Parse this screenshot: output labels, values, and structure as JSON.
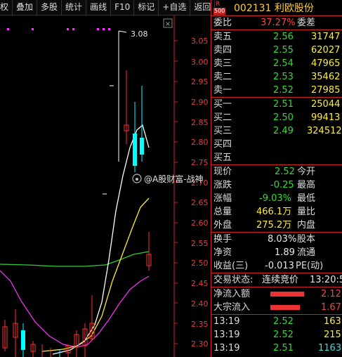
{
  "toolbar": {
    "items": [
      "权",
      "叠加",
      "多股",
      "统计",
      "画线",
      "F10",
      "标记",
      "+自选",
      "返回"
    ]
  },
  "chart": {
    "price_axis": [
      "3.05",
      "3.00",
      "2.95",
      "2.90",
      "2.85",
      "2.80",
      "2.75",
      "2.70",
      "2.65",
      "2.60",
      "2.55",
      "2.50",
      "2.45",
      "2.40",
      "2.35",
      "2.30"
    ],
    "high_label": "3.08",
    "watermark": "@A股财富-战神",
    "colors": {
      "up": "#ff3030",
      "down": "#00ffff",
      "ma_white": "#ffffff",
      "ma_yellow": "#ffff00",
      "ma_green": "#33cc33",
      "ma_magenta": "#ff33ff",
      "axis_text": "#e04040"
    }
  },
  "quote": {
    "badge_r": "R",
    "badge_num": "500",
    "code": "002131",
    "name": "利欧股份",
    "weibi_label": "委比",
    "weibi_value": "37.27%",
    "weicha_label": "委差",
    "asks": [
      {
        "label": "卖五",
        "price": "2.56",
        "vol": "31747"
      },
      {
        "label": "卖四",
        "price": "2.55",
        "vol": "62027"
      },
      {
        "label": "卖三",
        "price": "2.54",
        "vol": "47965"
      },
      {
        "label": "卖二",
        "price": "2.53",
        "vol": "35462"
      },
      {
        "label": "卖一",
        "price": "2.52",
        "vol": "27985"
      }
    ],
    "bids": [
      {
        "label": "买一",
        "price": "2.51",
        "vol": "25044"
      },
      {
        "label": "买二",
        "price": "2.50",
        "vol": "99413"
      },
      {
        "label": "买三",
        "price": "2.49",
        "vol": "324512"
      },
      {
        "label": "买四",
        "price": "",
        "vol": ""
      },
      {
        "label": "买五",
        "price": "",
        "vol": ""
      }
    ],
    "stats": [
      {
        "l1": "现价",
        "v1": "2.52",
        "l2": "今开",
        "color": "green"
      },
      {
        "l1": "涨跌",
        "v1": "-0.25",
        "l2": "最高",
        "color": "green"
      },
      {
        "l1": "涨幅",
        "v1": "-9.03%",
        "l2": "最低",
        "color": "green"
      },
      {
        "l1": "总量",
        "v1": "466.1万",
        "l2": "量比",
        "color": "yellow"
      },
      {
        "l1": "外盘",
        "v1": "275.2万",
        "l2": "内盘",
        "color": "yellow"
      }
    ],
    "stats2": [
      {
        "l1": "换手",
        "v1": "8.03%",
        "l2": "股本"
      },
      {
        "l1": "净资",
        "v1": "1.89",
        "l2": "流通"
      },
      {
        "l1": "收益(三)",
        "v1": "-0.013",
        "l2": "PE(动)"
      }
    ],
    "trade_status_label": "交易状态:",
    "trade_status_value": "连续竞价",
    "trade_time": "13:20:5",
    "flows": [
      {
        "label": "净流入额",
        "value": "2.12"
      },
      {
        "label": "大宗流入",
        "value": "1.67"
      }
    ],
    "ticks": [
      {
        "time": "13:19",
        "price": "2.52",
        "vol": "163"
      },
      {
        "time": "13:19",
        "price": "2.52",
        "vol": "215"
      },
      {
        "time": "13:19",
        "price": "2.51",
        "vol": "1163"
      }
    ]
  }
}
